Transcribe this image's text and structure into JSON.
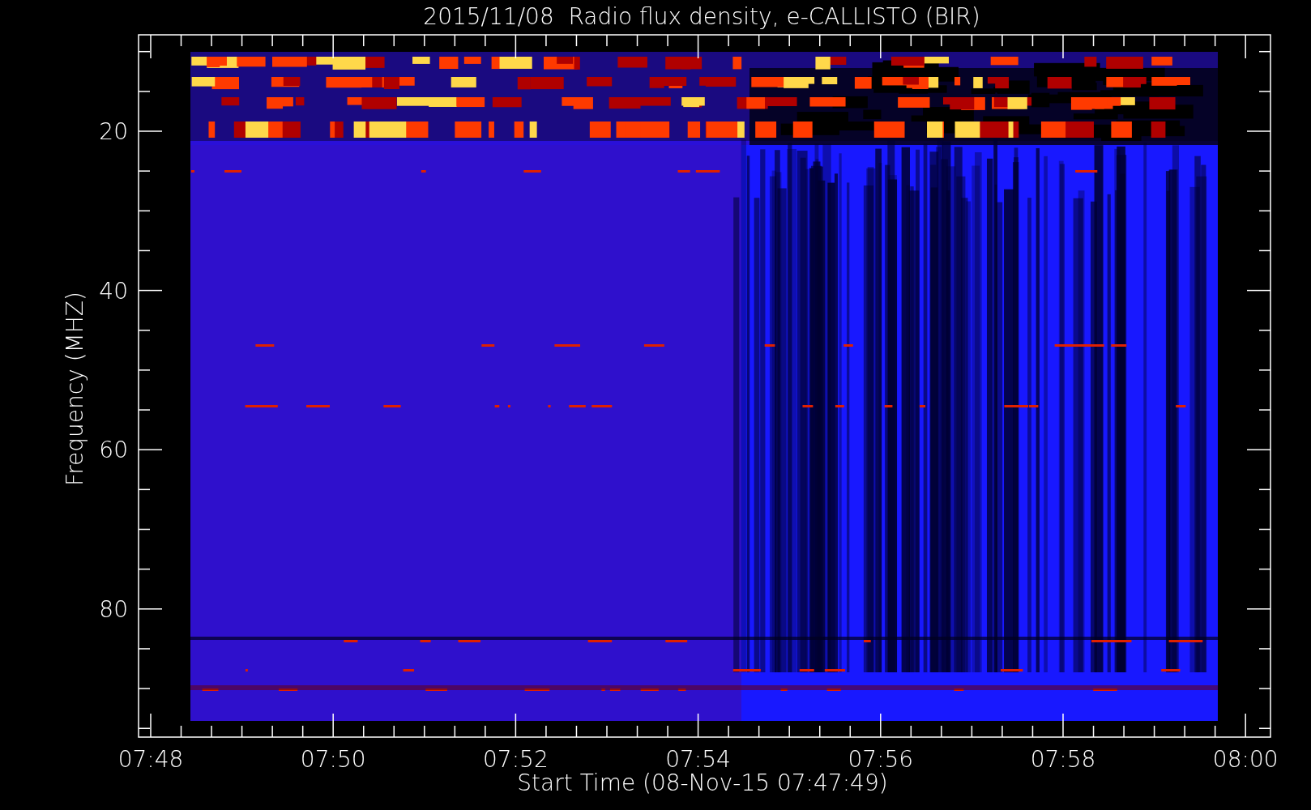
{
  "plot": {
    "title": "2015/11/08  Radio flux density, e-CALLISTO (BIR)",
    "xlabel": "Start Time (08-Nov-15 07:47:49)",
    "ylabel": "Frequency (MHZ)",
    "x_tick_labels": [
      "07:48",
      "07:50",
      "07:52",
      "07:54",
      "07:56",
      "07:58",
      "08:00"
    ],
    "y_tick_labels": [
      "20",
      "40",
      "60",
      "80"
    ]
  }
}
